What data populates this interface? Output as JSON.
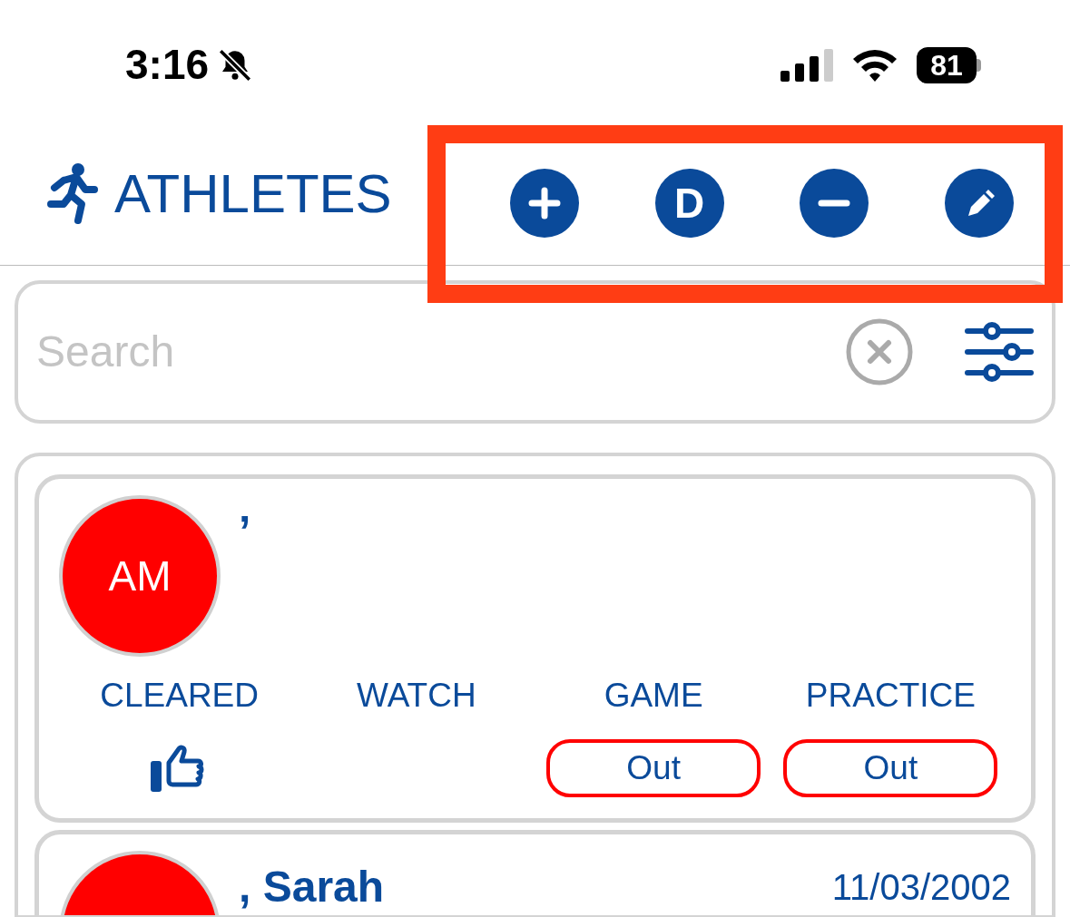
{
  "status_bar": {
    "time": "3:16",
    "battery": "81"
  },
  "header": {
    "title": "ATHLETES",
    "actions": [
      {
        "kind": "add"
      },
      {
        "kind": "letter",
        "label": "D"
      },
      {
        "kind": "remove"
      },
      {
        "kind": "edit"
      }
    ]
  },
  "search": {
    "placeholder": "Search"
  },
  "athletes": [
    {
      "initials": "AM",
      "name": "’",
      "statuses": [
        {
          "label": "CLEARED",
          "kind": "thumb"
        },
        {
          "label": "WATCH",
          "kind": "empty"
        },
        {
          "label": "GAME",
          "kind": "pill",
          "value": "Out"
        },
        {
          "label": "PRACTICE",
          "kind": "pill",
          "value": "Out"
        }
      ]
    },
    {
      "name": ", Sarah",
      "date": "11/03/2002"
    }
  ]
}
